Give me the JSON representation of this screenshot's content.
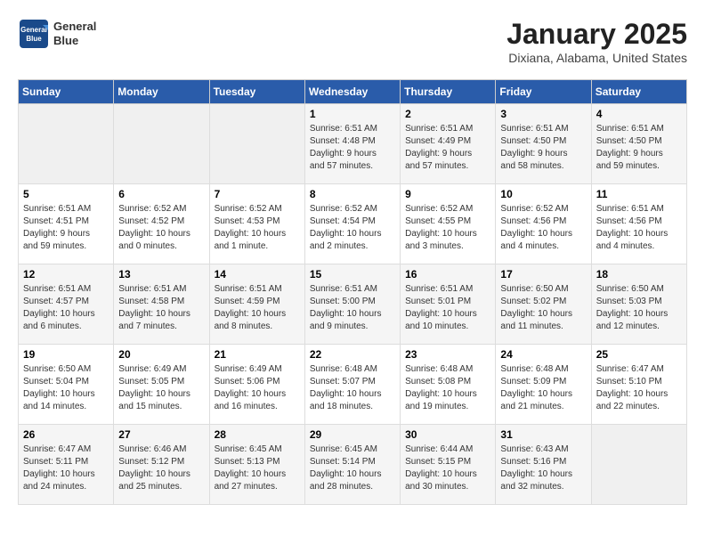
{
  "header": {
    "logo_line1": "General",
    "logo_line2": "Blue",
    "main_title": "January 2025",
    "subtitle": "Dixiana, Alabama, United States"
  },
  "weekdays": [
    "Sunday",
    "Monday",
    "Tuesday",
    "Wednesday",
    "Thursday",
    "Friday",
    "Saturday"
  ],
  "weeks": [
    [
      {
        "day": "",
        "info": ""
      },
      {
        "day": "",
        "info": ""
      },
      {
        "day": "",
        "info": ""
      },
      {
        "day": "1",
        "info": "Sunrise: 6:51 AM\nSunset: 4:48 PM\nDaylight: 9 hours\nand 57 minutes."
      },
      {
        "day": "2",
        "info": "Sunrise: 6:51 AM\nSunset: 4:49 PM\nDaylight: 9 hours\nand 57 minutes."
      },
      {
        "day": "3",
        "info": "Sunrise: 6:51 AM\nSunset: 4:50 PM\nDaylight: 9 hours\nand 58 minutes."
      },
      {
        "day": "4",
        "info": "Sunrise: 6:51 AM\nSunset: 4:50 PM\nDaylight: 9 hours\nand 59 minutes."
      }
    ],
    [
      {
        "day": "5",
        "info": "Sunrise: 6:51 AM\nSunset: 4:51 PM\nDaylight: 9 hours\nand 59 minutes."
      },
      {
        "day": "6",
        "info": "Sunrise: 6:52 AM\nSunset: 4:52 PM\nDaylight: 10 hours\nand 0 minutes."
      },
      {
        "day": "7",
        "info": "Sunrise: 6:52 AM\nSunset: 4:53 PM\nDaylight: 10 hours\nand 1 minute."
      },
      {
        "day": "8",
        "info": "Sunrise: 6:52 AM\nSunset: 4:54 PM\nDaylight: 10 hours\nand 2 minutes."
      },
      {
        "day": "9",
        "info": "Sunrise: 6:52 AM\nSunset: 4:55 PM\nDaylight: 10 hours\nand 3 minutes."
      },
      {
        "day": "10",
        "info": "Sunrise: 6:52 AM\nSunset: 4:56 PM\nDaylight: 10 hours\nand 4 minutes."
      },
      {
        "day": "11",
        "info": "Sunrise: 6:51 AM\nSunset: 4:56 PM\nDaylight: 10 hours\nand 4 minutes."
      }
    ],
    [
      {
        "day": "12",
        "info": "Sunrise: 6:51 AM\nSunset: 4:57 PM\nDaylight: 10 hours\nand 6 minutes."
      },
      {
        "day": "13",
        "info": "Sunrise: 6:51 AM\nSunset: 4:58 PM\nDaylight: 10 hours\nand 7 minutes."
      },
      {
        "day": "14",
        "info": "Sunrise: 6:51 AM\nSunset: 4:59 PM\nDaylight: 10 hours\nand 8 minutes."
      },
      {
        "day": "15",
        "info": "Sunrise: 6:51 AM\nSunset: 5:00 PM\nDaylight: 10 hours\nand 9 minutes."
      },
      {
        "day": "16",
        "info": "Sunrise: 6:51 AM\nSunset: 5:01 PM\nDaylight: 10 hours\nand 10 minutes."
      },
      {
        "day": "17",
        "info": "Sunrise: 6:50 AM\nSunset: 5:02 PM\nDaylight: 10 hours\nand 11 minutes."
      },
      {
        "day": "18",
        "info": "Sunrise: 6:50 AM\nSunset: 5:03 PM\nDaylight: 10 hours\nand 12 minutes."
      }
    ],
    [
      {
        "day": "19",
        "info": "Sunrise: 6:50 AM\nSunset: 5:04 PM\nDaylight: 10 hours\nand 14 minutes."
      },
      {
        "day": "20",
        "info": "Sunrise: 6:49 AM\nSunset: 5:05 PM\nDaylight: 10 hours\nand 15 minutes."
      },
      {
        "day": "21",
        "info": "Sunrise: 6:49 AM\nSunset: 5:06 PM\nDaylight: 10 hours\nand 16 minutes."
      },
      {
        "day": "22",
        "info": "Sunrise: 6:48 AM\nSunset: 5:07 PM\nDaylight: 10 hours\nand 18 minutes."
      },
      {
        "day": "23",
        "info": "Sunrise: 6:48 AM\nSunset: 5:08 PM\nDaylight: 10 hours\nand 19 minutes."
      },
      {
        "day": "24",
        "info": "Sunrise: 6:48 AM\nSunset: 5:09 PM\nDaylight: 10 hours\nand 21 minutes."
      },
      {
        "day": "25",
        "info": "Sunrise: 6:47 AM\nSunset: 5:10 PM\nDaylight: 10 hours\nand 22 minutes."
      }
    ],
    [
      {
        "day": "26",
        "info": "Sunrise: 6:47 AM\nSunset: 5:11 PM\nDaylight: 10 hours\nand 24 minutes."
      },
      {
        "day": "27",
        "info": "Sunrise: 6:46 AM\nSunset: 5:12 PM\nDaylight: 10 hours\nand 25 minutes."
      },
      {
        "day": "28",
        "info": "Sunrise: 6:45 AM\nSunset: 5:13 PM\nDaylight: 10 hours\nand 27 minutes."
      },
      {
        "day": "29",
        "info": "Sunrise: 6:45 AM\nSunset: 5:14 PM\nDaylight: 10 hours\nand 28 minutes."
      },
      {
        "day": "30",
        "info": "Sunrise: 6:44 AM\nSunset: 5:15 PM\nDaylight: 10 hours\nand 30 minutes."
      },
      {
        "day": "31",
        "info": "Sunrise: 6:43 AM\nSunset: 5:16 PM\nDaylight: 10 hours\nand 32 minutes."
      },
      {
        "day": "",
        "info": ""
      }
    ]
  ]
}
